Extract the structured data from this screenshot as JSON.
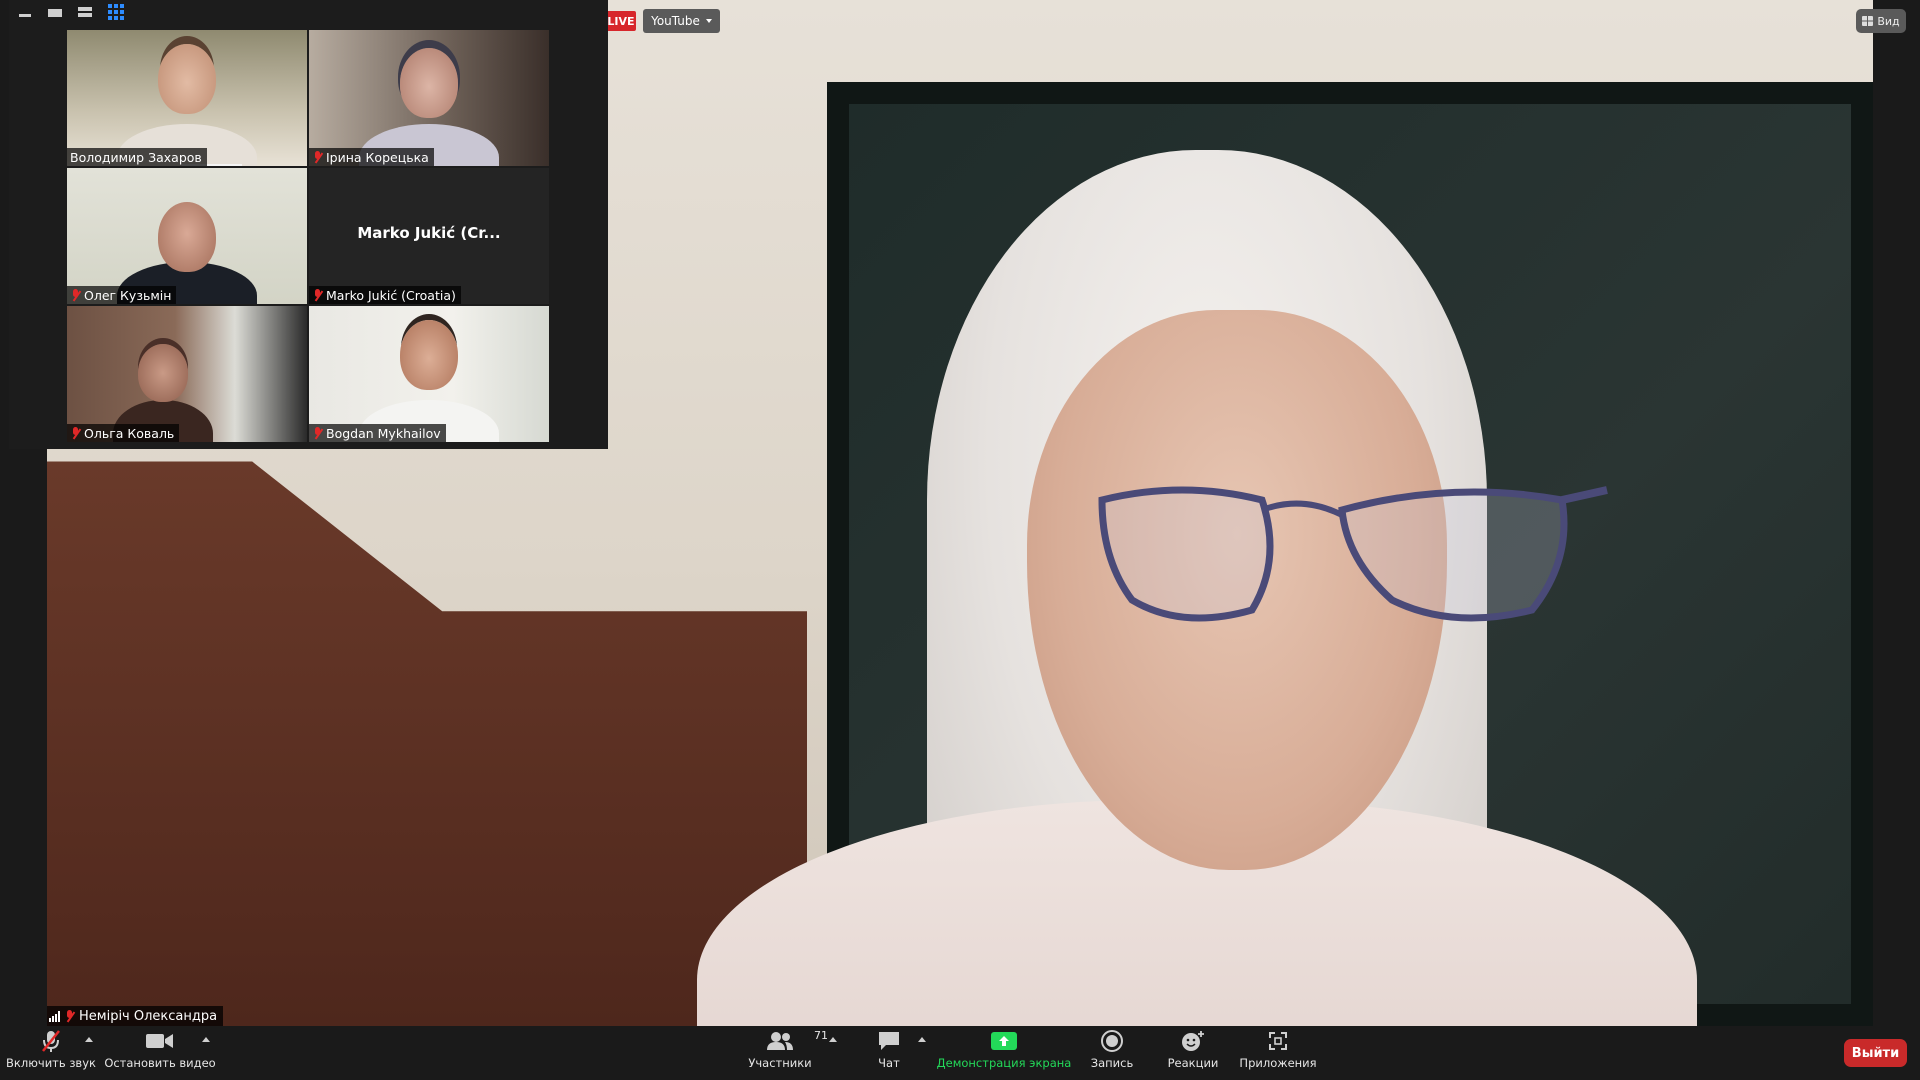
{
  "overlay": {
    "live_label": "LIVE",
    "stream_label": "YouTube",
    "view_label": "Вид"
  },
  "speaker": {
    "name": "Неміріч Олександра"
  },
  "gallery": {
    "participants": [
      {
        "name": "Володимир Захаров",
        "muted": false,
        "video": true
      },
      {
        "name": "Ірина Корецька",
        "muted": true,
        "video": true
      },
      {
        "name": "Олег Кузьмін",
        "muted": true,
        "video": true
      },
      {
        "name": "Marko Jukić (Croatia)",
        "display_name": "Marko Jukić  (Cr...",
        "muted": true,
        "video": false
      },
      {
        "name": "Ольга Коваль",
        "muted": true,
        "video": true
      },
      {
        "name": "Bogdan Mykhailov",
        "muted": true,
        "video": true
      }
    ]
  },
  "toolbar": {
    "unmute_label": "Включить звук",
    "stop_video_label": "Остановить видео",
    "participants_label": "Участники",
    "participants_count": "71",
    "chat_label": "Чат",
    "share_label": "Демонстрация экрана",
    "record_label": "Запись",
    "reactions_label": "Реакции",
    "apps_label": "Приложения",
    "leave_label": "Выйти"
  },
  "colors": {
    "share_green": "#23d959",
    "leave_red": "#c92a2a",
    "live_red": "#d7262b",
    "grid_blue": "#2d8cff"
  }
}
